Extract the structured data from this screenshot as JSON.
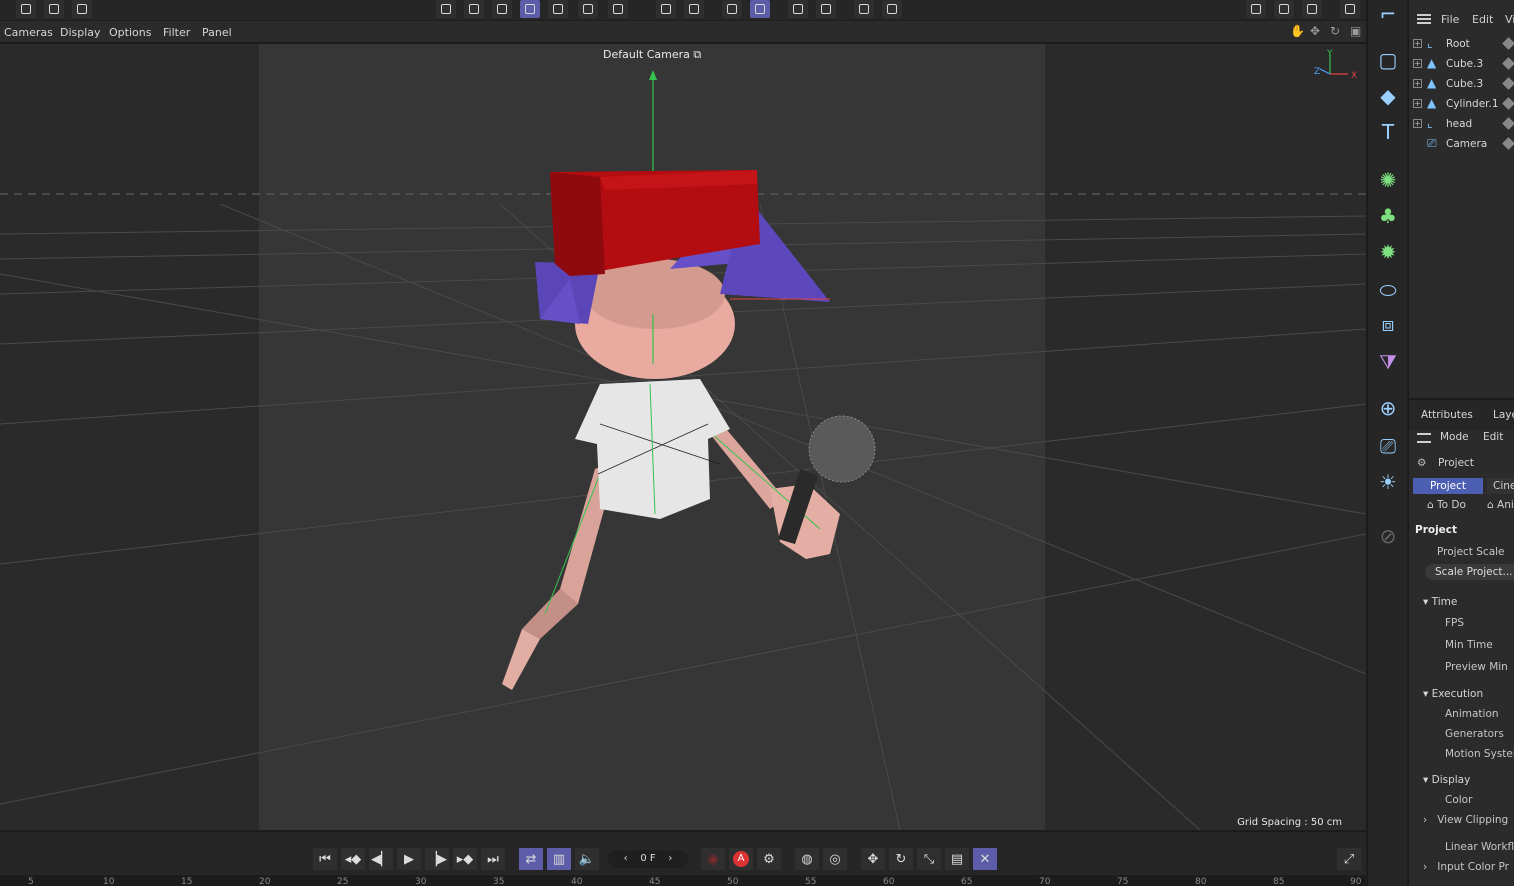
{
  "viewport_menu": [
    "Cameras",
    "Display",
    "Options",
    "Filter",
    "Panel"
  ],
  "viewport": {
    "camera_label": "Default Camera",
    "grid_spacing": "Grid Spacing : 50 cm",
    "axis_labels": {
      "y": "Y",
      "z": "Z",
      "x": "X"
    }
  },
  "objects_panel": {
    "menu": [
      "File",
      "Edit",
      "Vi"
    ],
    "items": [
      {
        "name": "Root",
        "icon": "joint-icon",
        "expandable": true
      },
      {
        "name": "Cube.3",
        "icon": "polygon-object-icon",
        "expandable": true
      },
      {
        "name": "Cube.3",
        "icon": "polygon-object-icon",
        "expandable": true
      },
      {
        "name": "Cylinder.1",
        "icon": "polygon-object-icon",
        "expandable": true
      },
      {
        "name": "head",
        "icon": "joint-icon",
        "expandable": true
      },
      {
        "name": "Camera",
        "icon": "camera-icon",
        "expandable": false
      }
    ]
  },
  "attributes_panel": {
    "tabs": [
      "Attributes",
      "Laye"
    ],
    "menu": [
      "Mode",
      "Edit"
    ],
    "context": "Project",
    "subtabs_row1": [
      "Project",
      "Cine"
    ],
    "subtabs_row2": [
      "To Do",
      "Ani"
    ],
    "section_title": "Project",
    "project_scale_label": "Project Scale",
    "scale_project_button": "Scale Project...",
    "groups": [
      {
        "title": "Time",
        "items": [
          "FPS",
          "Min Time",
          "Preview Min"
        ]
      },
      {
        "title": "Execution",
        "items": [
          "Animation",
          "Generators",
          "Motion System"
        ]
      },
      {
        "title": "Display",
        "items": [
          "Color",
          "View Clipping"
        ]
      }
    ],
    "trailing_items": [
      "Linear Workflo",
      "Input Color Pr"
    ]
  },
  "playback": {
    "frame_field": "0 F",
    "record_label": "A"
  },
  "timeline_ticks": [
    "5",
    "10",
    "15",
    "20",
    "25",
    "30",
    "35",
    "40",
    "45",
    "50",
    "55",
    "60",
    "65",
    "70",
    "75",
    "80",
    "85",
    "90"
  ],
  "colors": {
    "accent": "#5c5ca8",
    "hat_red": "#b30d12",
    "hair_purple": "#6650c8",
    "skin": "#e9aaa0",
    "shirt": "#e6e6e6",
    "axis_green": "#36c24f",
    "axis_red": "#e04040",
    "axis_blue": "#4aa0ff"
  }
}
